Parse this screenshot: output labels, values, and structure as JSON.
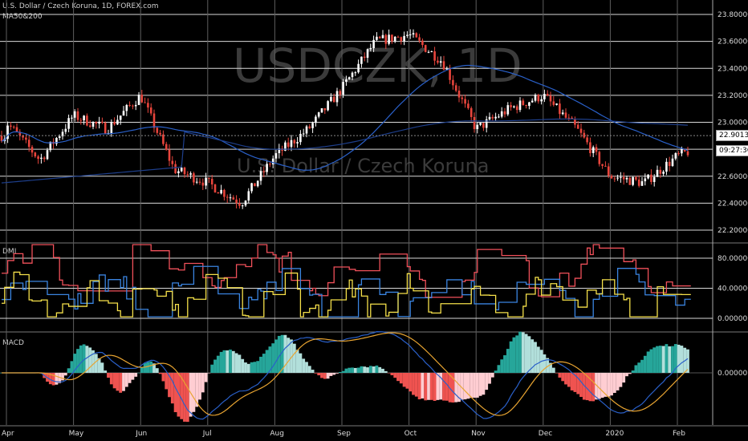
{
  "header": {
    "symbol_line": "U.S. Dollar / Czech Koruna, 1D, FOREX.com",
    "indicator_line": "MA50&200"
  },
  "watermark": {
    "ticker": "USDCZK, 1D",
    "name": "U.S. Dollar / Czech Koruna"
  },
  "panels": {
    "dmi_label": "DMI",
    "macd_label": "MACD"
  },
  "price_tag": "22.90138",
  "countdown": "09:27:36",
  "colors": {
    "up": "#ffffff",
    "down": "#e8453c",
    "ma_short": "#2a60c9",
    "ma_long": "#1e3f8c",
    "dmi_adx": "#f0505a",
    "dmi_plus": "#3a84e0",
    "dmi_minus": "#f5e04a",
    "macd_line": "#2a60c9",
    "signal_line": "#e8a431",
    "hist_pos": "#26a69a",
    "hist_pos_light": "#b2dfdb",
    "hist_neg": "#ef5350",
    "hist_neg_light": "#ffcdd2"
  },
  "chart_data": {
    "type": "candlestick",
    "x_labels": [
      "Apr",
      "May",
      "Jun",
      "Jul",
      "Aug",
      "Sep",
      "Oct",
      "Nov",
      "Dec",
      "2020",
      "Feb"
    ],
    "price_axis": {
      "ticks": [
        "23.80000",
        "23.60000",
        "23.40000",
        "23.20000",
        "23.00000",
        "22.80000",
        "22.60000",
        "22.40000",
        "22.20000"
      ],
      "ylim": [
        22.2,
        23.8
      ]
    },
    "price_path": [
      {
        "month": "Apr",
        "start": 23.0,
        "mid": 22.72,
        "end": 22.75
      },
      {
        "month": "May",
        "start": 23.05,
        "mid": 22.95,
        "end": 23.05
      },
      {
        "month": "Jun",
        "start": 23.2,
        "mid": 22.65,
        "end": 22.75
      },
      {
        "month": "Jul",
        "start": 22.55,
        "mid": 22.4,
        "end": 22.68
      },
      {
        "month": "Aug",
        "start": 22.75,
        "mid": 22.95,
        "end": 23.1
      },
      {
        "month": "Sep",
        "start": 23.25,
        "mid": 23.6,
        "end": 23.48
      },
      {
        "month": "Oct",
        "start": 23.65,
        "mid": 23.45,
        "end": 23.0
      },
      {
        "month": "Nov",
        "start": 22.95,
        "mid": 23.1,
        "end": 23.15
      },
      {
        "month": "Dec",
        "start": 23.2,
        "mid": 22.95,
        "end": 22.7
      },
      {
        "month": "2020",
        "start": 22.6,
        "mid": 22.55,
        "end": 22.6
      },
      {
        "month": "Feb",
        "start": 22.75,
        "mid": 22.85,
        "end": 22.9
      }
    ],
    "dmi_axis": {
      "ticks": [
        "80.00000",
        "40.00000",
        "0.00000"
      ],
      "ylim": [
        0,
        100
      ]
    },
    "macd_axis": {
      "ticks": [
        "0.00000"
      ]
    }
  }
}
